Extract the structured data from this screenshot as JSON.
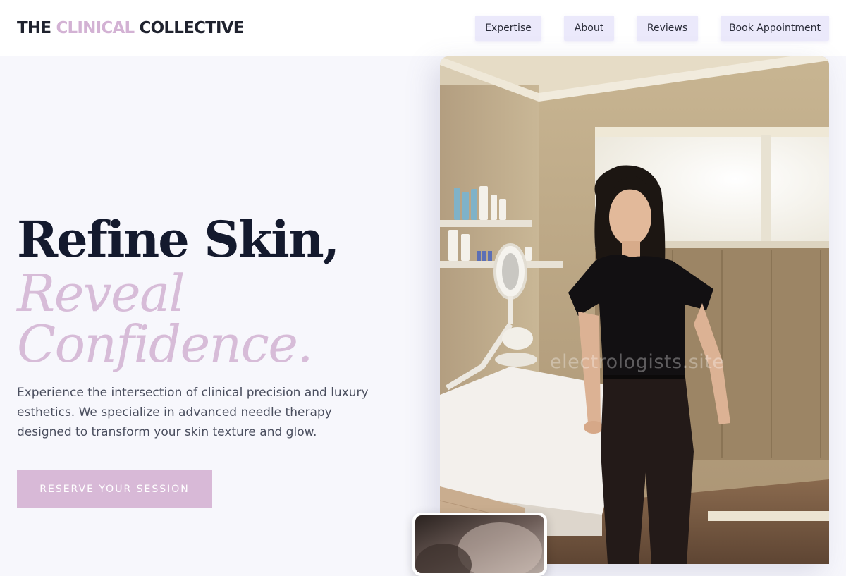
{
  "brand": {
    "part1": "THE",
    "part2": "CLINICAL",
    "part3": "COLLECTIVE"
  },
  "nav": {
    "expertise": "Expertise",
    "about": "About",
    "reviews": "Reviews",
    "book": "Book Appointment"
  },
  "hero": {
    "line1": "Refine Skin,",
    "line2": "Reveal",
    "line3": "Confidence.",
    "description": "Experience the intersection of clinical precision and luxury esthetics. We specialize in advanced needle therapy designed to transform your skin texture and glow.",
    "cta": "RESERVE YOUR SESSION"
  },
  "media": {
    "watermark": "electrologists.site",
    "main_photo_icon": "esthetician-portrait-photo",
    "thumbnail_icon": "treatment-closeup-photo"
  },
  "colors": {
    "accent": "#d8b9d7",
    "nav_button_bg": "#ebe9fb",
    "title": "#141a2e",
    "background": "#f7f7fc"
  }
}
